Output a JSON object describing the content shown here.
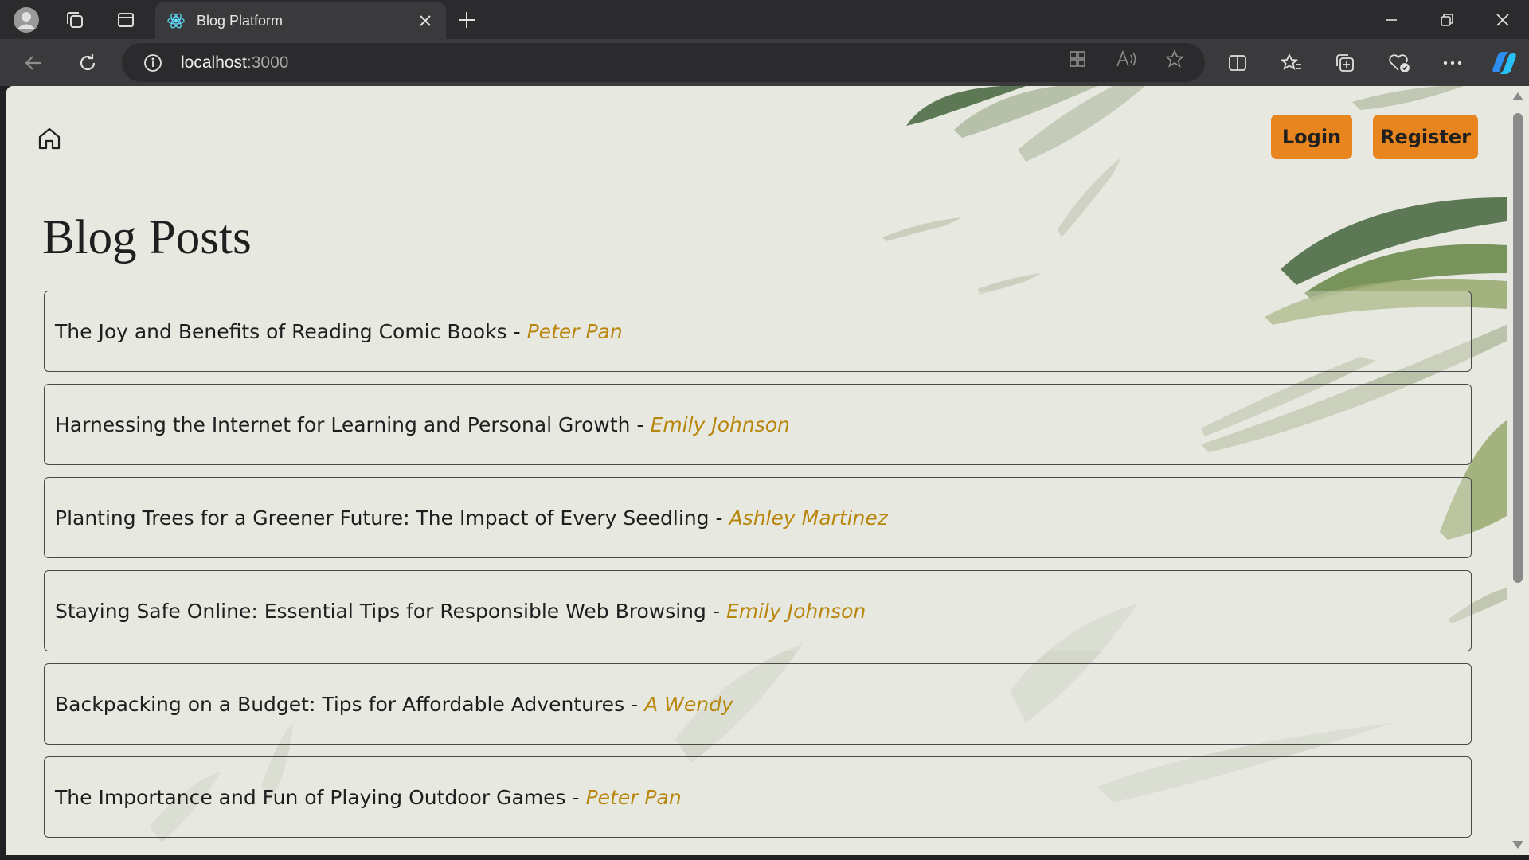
{
  "browser": {
    "tab_title": "Blog Platform",
    "url_host": "localhost",
    "url_port": ":3000"
  },
  "nav": {
    "login_label": "Login",
    "register_label": "Register"
  },
  "page": {
    "title": "Blog Posts"
  },
  "posts": [
    {
      "title": "The Joy and Benefits of Reading Comic Books",
      "separator": "-",
      "author": "Peter Pan"
    },
    {
      "title": "Harnessing the Internet for Learning and Personal Growth",
      "separator": "-",
      "author": "Emily Johnson"
    },
    {
      "title": "Planting Trees for a Greener Future: The Impact of Every Seedling",
      "separator": "-",
      "author": "Ashley Martinez"
    },
    {
      "title": "Staying Safe Online: Essential Tips for Responsible Web Browsing",
      "separator": "-",
      "author": "Emily Johnson"
    },
    {
      "title": "Backpacking on a Budget: Tips for Affordable Adventures",
      "separator": "-",
      "author": "A Wendy"
    },
    {
      "title": "The Importance and Fun of Playing Outdoor Games",
      "separator": "-",
      "author": "Peter Pan"
    }
  ],
  "colors": {
    "accent_button": "#e8851e",
    "author_text": "#b8860b",
    "page_background": "#e7e8e0"
  }
}
